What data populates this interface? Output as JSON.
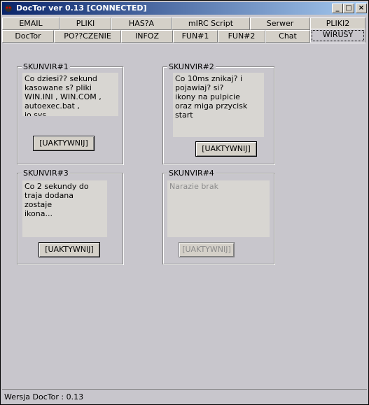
{
  "window": {
    "title": "DocTor ver 0.13 [CONNECTED]",
    "controls": {
      "minimize": "_",
      "maximize": "□",
      "close": "×"
    }
  },
  "tabs": {
    "row1": [
      "EMAIL",
      "PLIKI",
      "HAS?A",
      "mIRC Script",
      "Serwer",
      "PLIKI2"
    ],
    "row2": [
      "DocTor",
      "PO??CZENIE",
      "INFOZ",
      "FUN#1",
      "FUN#2",
      "Chat",
      "WIRUSY"
    ],
    "active": "WIRUSY"
  },
  "viruses": [
    {
      "label": "SKUNVIR#1",
      "description": "Co dziesi?? sekund\nkasowane s? pliki\nWIN.INI , WIN.COM ,\nautoexec.bat ,\nio.sys.",
      "button": "[UAKTYWNIJ]",
      "enabled": true
    },
    {
      "label": "SKUNVIR#2",
      "description": "Co 10ms znikaj? i\npojawiaj? si?\nikony na pulpicie\noraz miga przycisk\nstart",
      "button": "[UAKTYWNIJ]",
      "enabled": true
    },
    {
      "label": "SKUNVIR#3",
      "description": "Co 2 sekundy do\ntraja dodana\nzostaje\nikona...",
      "button": "[UAKTYWNIJ]",
      "enabled": true
    },
    {
      "label": "SKUNVIR#4",
      "description": "Narazie brak",
      "button": "[UAKTYWNIJ]",
      "enabled": false
    }
  ],
  "status": {
    "text": "Wersja DocTor : 0.13"
  }
}
